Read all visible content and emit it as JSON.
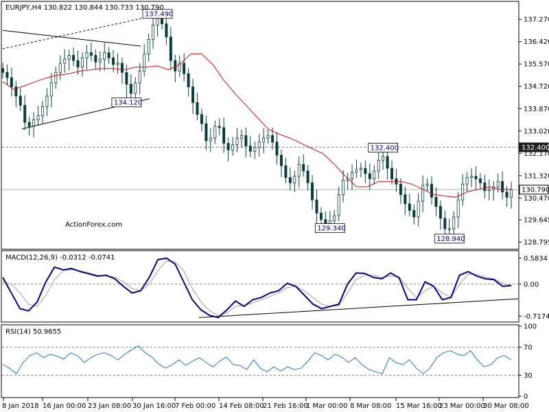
{
  "main": {
    "symbol": "EURJPY,H4",
    "ohlc": [
      "130.822",
      "130.844",
      "130.733",
      "130.790"
    ],
    "ylim": [
      128.6,
      137.9
    ],
    "y_ticks": [
      "137.270",
      "136.420",
      "135.570",
      "134.720",
      "133.870",
      "133.020",
      "132.170",
      "131.320",
      "130.470",
      "129.645",
      "128.795"
    ],
    "price_tags": [
      {
        "label": "132.400",
        "value": 132.4,
        "style": "dark"
      },
      {
        "label": "130.790",
        "value": 130.79,
        "style": "light"
      }
    ],
    "callouts": [
      {
        "label": "137.490",
        "value": 137.49,
        "bar": 35
      },
      {
        "label": "134.120",
        "value": 134.12,
        "bar": 28
      },
      {
        "label": "132.400",
        "value": 132.4,
        "bar": 86
      },
      {
        "label": "129.340",
        "value": 129.34,
        "bar": 74
      },
      {
        "label": "128.940",
        "value": 128.94,
        "bar": 101
      }
    ],
    "watermark": "ActionForex.com"
  },
  "macd": {
    "header": "MACD(12,26,9) -0.0312 -0.0741",
    "ylim": [
      -0.82,
      0.72
    ],
    "y_ticks": [
      "0.5834",
      "0.00",
      "-0.7174"
    ]
  },
  "rsi": {
    "header": "RSI(14) 50.9655",
    "ylim": [
      0,
      100
    ],
    "y_ticks": [
      "100",
      "70",
      "30",
      "0"
    ]
  },
  "x_ticks": [
    "8 Jan 2018",
    "16 Jan 00:00",
    "23 Jan 08:00",
    "30 Jan 16:00",
    "7 Feb 00:00",
    "14 Feb 08:00",
    "21 Feb 16:00",
    "1 Mar 00:00",
    "8 Mar 08:00",
    "15 Mar 16:00",
    "23 Mar 00:00",
    "30 Mar 08:00"
  ],
  "colors": {
    "ma": "#d01010",
    "macd": "#000080",
    "signal": "#a0a0a0",
    "rsi": "#1e78c8",
    "candle": "#0a3d3d",
    "grid_dash": "#808080",
    "tag_dark": "#202020",
    "callout_text": "#000080"
  },
  "chart_data": {
    "type": "candlestick",
    "instrument": "EURJPY",
    "timeframe": "H4",
    "close": [
      135.25,
      135.05,
      134.7,
      134.35,
      134,
      133.35,
      133.2,
      133.45,
      133.6,
      133.95,
      134.35,
      134.85,
      135.25,
      135.6,
      135.75,
      135.9,
      135.7,
      135.45,
      135.8,
      136,
      135.9,
      135.65,
      135.75,
      136.0,
      135.8,
      135.55,
      135.6,
      135.25,
      134.8,
      134.45,
      134.85,
      135.3,
      135.95,
      136.5,
      137.05,
      137.3,
      137.1,
      136.6,
      135.7,
      135.3,
      135.6,
      135.2,
      134.7,
      134.1,
      133.65,
      133.3,
      132.65,
      132.75,
      133.2,
      133.15,
      132.55,
      132.3,
      132.5,
      132.75,
      132.85,
      132.45,
      132.25,
      132.4,
      132.6,
      132.75,
      132.85,
      132.6,
      132.1,
      131.7,
      131.25,
      131.05,
      131.3,
      131.75,
      131.5,
      131.05,
      130.4,
      129.9,
      129.65,
      129.5,
      129.6,
      129.8,
      130.6,
      131.15,
      131.2,
      131.45,
      131.55,
      131.6,
      131.4,
      131.2,
      131.5,
      131.9,
      132.05,
      131.6,
      131.2,
      131.0,
      130.6,
      130.25,
      130.0,
      129.75,
      130.35,
      130.95,
      131.0,
      130.5,
      130.15,
      129.7,
      129.3,
      129.3,
      129.75,
      130.4,
      131.0,
      131.25,
      131.3,
      131.2,
      131.05,
      130.75,
      130.8,
      130.9,
      131.1,
      130.7,
      130.5,
      130.79
    ],
    "moving_average": [
      134.9,
      134.6,
      134.75,
      134.9,
      135.05,
      135.15,
      135.2,
      135.3,
      135.35,
      135.4,
      135.4,
      135.35,
      135.45,
      135.45,
      135.5,
      135.35,
      135.55,
      135.95,
      135.95,
      135.55,
      134.95,
      134.45,
      134.0,
      133.55,
      133.1,
      132.9,
      132.75,
      132.55,
      132.35,
      132.15,
      131.75,
      131.3,
      130.9,
      130.9,
      131.1,
      131.1,
      131.1,
      131.0,
      130.8,
      130.6,
      130.55,
      130.5,
      130.7,
      130.8,
      130.9,
      130.8,
      130.8
    ],
    "ylim": [
      128.6,
      137.9
    ],
    "macd": {
      "main": [
        0.15,
        -0.2,
        -0.55,
        -0.6,
        -0.4,
        0.05,
        0.38,
        0.32,
        0.35,
        0.28,
        0.23,
        0.18,
        0.2,
        0.12,
        -0.05,
        -0.2,
        -0.15,
        0.15,
        0.55,
        0.58,
        0.45,
        0.05,
        -0.35,
        -0.58,
        -0.7,
        -0.75,
        -0.58,
        -0.38,
        -0.5,
        -0.35,
        -0.3,
        -0.2,
        -0.15,
        0.02,
        -0.05,
        -0.25,
        -0.45,
        -0.55,
        -0.5,
        -0.45,
        0.0,
        0.25,
        0.24,
        0.15,
        0.12,
        0.25,
        0.14,
        -0.35,
        -0.35,
        0.05,
        -0.05,
        -0.35,
        -0.3,
        0.2,
        0.28,
        0.18,
        0.12,
        0.1,
        -0.05,
        -0.03
      ],
      "signal": [
        0.05,
        0.0,
        -0.2,
        -0.45,
        -0.5,
        -0.25,
        0.1,
        0.3,
        0.32,
        0.3,
        0.25,
        0.2,
        0.18,
        0.16,
        0.05,
        -0.1,
        -0.15,
        0.0,
        0.3,
        0.52,
        0.5,
        0.3,
        -0.1,
        -0.4,
        -0.6,
        -0.7,
        -0.65,
        -0.5,
        -0.48,
        -0.42,
        -0.35,
        -0.28,
        -0.2,
        -0.08,
        -0.05,
        -0.15,
        -0.3,
        -0.45,
        -0.5,
        -0.48,
        -0.2,
        0.1,
        0.2,
        0.2,
        0.15,
        0.18,
        0.16,
        -0.1,
        -0.3,
        -0.15,
        -0.05,
        -0.2,
        -0.3,
        0.0,
        0.22,
        0.22,
        0.16,
        0.12,
        0.02,
        -0.04
      ],
      "ylim": [
        -0.82,
        0.72
      ]
    },
    "rsi": {
      "values": [
        45,
        40,
        32,
        48,
        58,
        62,
        55,
        60,
        57,
        53,
        62,
        58,
        48,
        55,
        60,
        62,
        58,
        52,
        60,
        66,
        72,
        62,
        56,
        46,
        40,
        45,
        52,
        44,
        50,
        55,
        48,
        42,
        50,
        56,
        45,
        44,
        38,
        52,
        40,
        35,
        42,
        36,
        42,
        38,
        40,
        50,
        62,
        58,
        52,
        60,
        56,
        48,
        55,
        45,
        38,
        35,
        32,
        55,
        48,
        45,
        52,
        40,
        32,
        40,
        55,
        62,
        65,
        60,
        58,
        65,
        52,
        42,
        45,
        55,
        58,
        52
      ],
      "ylim": [
        0,
        100
      ],
      "levels": [
        70,
        30
      ]
    }
  }
}
